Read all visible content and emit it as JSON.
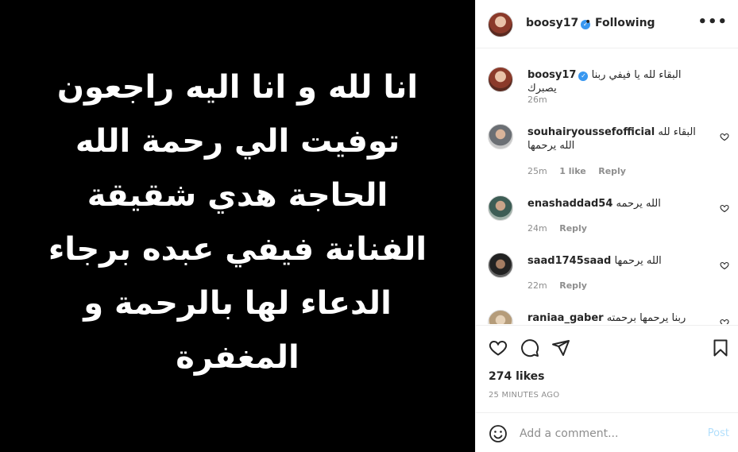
{
  "post": {
    "image_lines": [
      "انا لله و انا اليه راجعون",
      "توفيت الي رحمة الله",
      "الحاجة هدي شقيقة",
      "الفنانة فيفي عبده برجاء",
      "الدعاء لها بالرحمة و",
      "المغفرة"
    ]
  },
  "header": {
    "username": "boosy17",
    "separator": "•",
    "follow_status": "Following",
    "more_icon": "more-horizontal-icon"
  },
  "caption": {
    "username": "boosy17",
    "text": "البقاء لله يا فيفي ربنا يصبرك",
    "time": "26m"
  },
  "comments": [
    {
      "username": "souhairyoussefofficial",
      "text": "البقاء لله الله يرحمها",
      "time": "25m",
      "likes": "1 like",
      "reply": "Reply"
    },
    {
      "username": "enashaddad54",
      "text": "الله يرحمه",
      "time": "24m",
      "likes": "",
      "reply": "Reply"
    },
    {
      "username": "saad1745saad",
      "text": "الله يرحمها",
      "time": "22m",
      "likes": "",
      "reply": "Reply"
    },
    {
      "username": "raniaa_gaber",
      "text": "ربنا يرحمها برحمته",
      "time": "",
      "likes": "",
      "reply": ""
    }
  ],
  "actions": {
    "likes": "274 likes",
    "posted_ago": "25 MINUTES AGO"
  },
  "add_comment": {
    "placeholder": "Add a comment...",
    "post_label": "Post"
  },
  "colors": {
    "accent": "#0095f6",
    "verified": "#3897f0",
    "muted": "#8e8e8e",
    "post_disabled": "#b2dffc"
  }
}
